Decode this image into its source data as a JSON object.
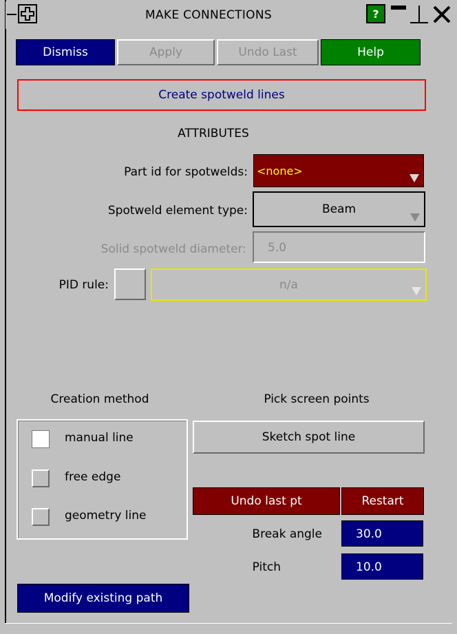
{
  "window": {
    "title": "MAKE CONNECTIONS",
    "help_icon_text": "?"
  },
  "toolbar": {
    "dismiss": "Dismiss",
    "apply": "Apply",
    "undo_last": "Undo Last",
    "help": "Help"
  },
  "mode_button": "Create spotweld lines",
  "attributes": {
    "heading": "ATTRIBUTES",
    "part_id_label": "Part id for spotwelds:",
    "part_id_value": "<none>",
    "element_type_label": "Spotweld element type:",
    "element_type_value": "Beam",
    "diameter_label": "Solid spotweld diameter:",
    "diameter_value": "5.0",
    "pid_rule_label": "PID rule:",
    "pid_rule_value": "n/a"
  },
  "creation": {
    "heading": "Creation method",
    "options": [
      {
        "label": "manual line",
        "selected": true
      },
      {
        "label": "free edge",
        "selected": false
      },
      {
        "label": "geometry line",
        "selected": false
      }
    ]
  },
  "pick": {
    "heading": "Pick screen points",
    "sketch_button": "Sketch spot line",
    "undo_pt": "Undo last pt",
    "restart": "Restart",
    "break_angle_label": "Break angle",
    "break_angle_value": "30.0",
    "pitch_label": "Pitch",
    "pitch_value": "10.0"
  },
  "modify_button": "Modify existing path",
  "colors": {
    "panel": "#c0c0c0",
    "navy": "#000080",
    "green": "#008000",
    "dark_red": "#800000",
    "yellow": "#ffff00",
    "red_border": "#ff0000"
  }
}
